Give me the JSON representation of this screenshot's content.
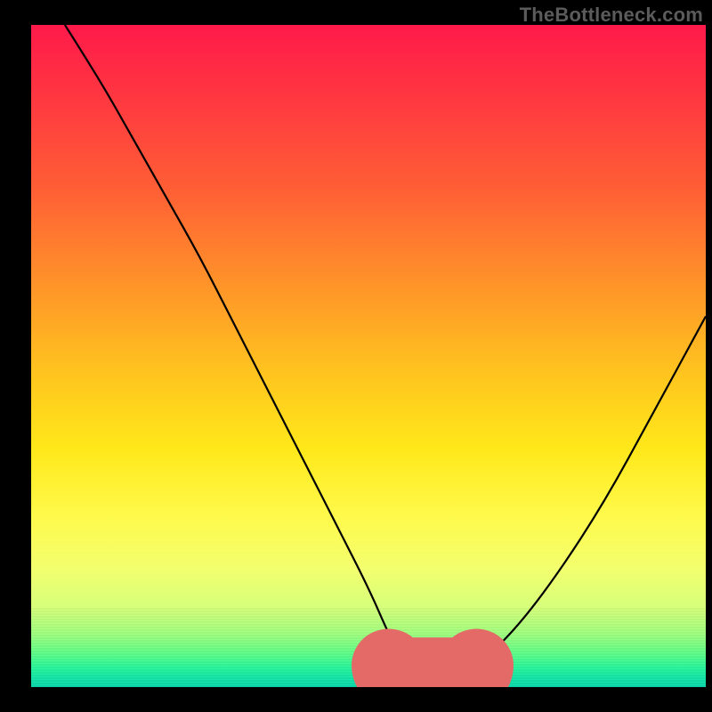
{
  "watermark": "TheBottleneck.com",
  "chart_data": {
    "type": "line",
    "title": "",
    "xlabel": "",
    "ylabel": "",
    "xlim": [
      0,
      100
    ],
    "ylim": [
      0,
      100
    ],
    "grid": false,
    "legend": false,
    "series": [
      {
        "name": "bottleneck-curve",
        "x": [
          5,
          10,
          15,
          20,
          25,
          30,
          35,
          40,
          45,
          50,
          53,
          55,
          57,
          60,
          63,
          67,
          72,
          78,
          85,
          92,
          100
        ],
        "y": [
          100,
          92,
          83,
          74,
          65,
          55,
          45,
          35,
          25,
          15,
          8,
          4,
          2,
          2,
          2,
          4,
          9,
          17,
          28,
          41,
          56
        ]
      }
    ],
    "background_gradient": {
      "direction": "vertical",
      "stops": [
        {
          "pos": 0.0,
          "color": "#ff1a4a"
        },
        {
          "pos": 0.25,
          "color": "#ff5f35"
        },
        {
          "pos": 0.52,
          "color": "#ffc21f"
        },
        {
          "pos": 0.74,
          "color": "#fff94a"
        },
        {
          "pos": 0.92,
          "color": "#9fff7e"
        },
        {
          "pos": 1.0,
          "color": "#0bd7ab"
        }
      ]
    },
    "marker": {
      "name": "optimal-range",
      "color": "#e46a68",
      "x_range": [
        53,
        66
      ],
      "y": 2
    }
  }
}
